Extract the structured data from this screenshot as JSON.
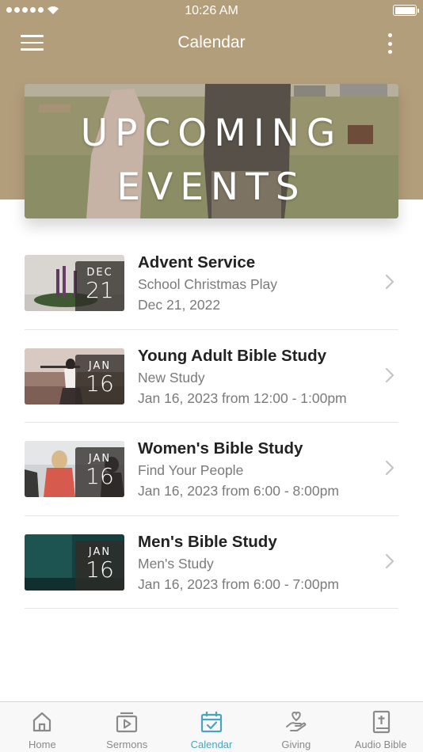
{
  "status_bar": {
    "time": "10:26 AM"
  },
  "nav": {
    "title": "Calendar"
  },
  "banner": {
    "line1": "UPCOMING",
    "line2": "EVENTS"
  },
  "events": [
    {
      "month": "DEC",
      "day": "21",
      "title": "Advent Service",
      "subtitle": "School Christmas Play",
      "date": "Dec 21, 2022"
    },
    {
      "month": "JAN",
      "day": "16",
      "title": "Young Adult Bible Study",
      "subtitle": "New Study",
      "date": "Jan 16, 2023 from 12:00 - 1:00pm"
    },
    {
      "month": "JAN",
      "day": "16",
      "title": "Women's Bible Study",
      "subtitle": "Find Your People",
      "date": "Jan 16, 2023 from 6:00 - 8:00pm"
    },
    {
      "month": "JAN",
      "day": "16",
      "title": "Men's Bible Study",
      "subtitle": "Men's Study",
      "date": "Jan 16, 2023 from 6:00 - 7:00pm"
    }
  ],
  "tabs": [
    {
      "label": "Home",
      "icon": "home-icon",
      "active": false
    },
    {
      "label": "Sermons",
      "icon": "video-play-icon",
      "active": false
    },
    {
      "label": "Calendar",
      "icon": "calendar-check-icon",
      "active": true
    },
    {
      "label": "Giving",
      "icon": "giving-hand-heart-icon",
      "active": false
    },
    {
      "label": "Audio Bible",
      "icon": "bible-book-icon",
      "active": false
    }
  ],
  "colors": {
    "header": "#b39e7b",
    "accent": "#4ba3bd",
    "tab_inactive": "#8a8a8a"
  }
}
